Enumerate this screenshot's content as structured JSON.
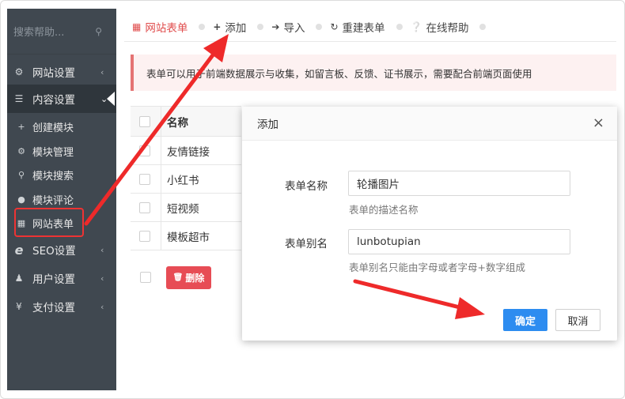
{
  "sidebar": {
    "search_placeholder": "搜索帮助...",
    "items": [
      {
        "label": "网站设置",
        "chevron": "‹"
      },
      {
        "label": "内容设置",
        "chevron": "⌄"
      },
      {
        "label": "SEO设置",
        "chevron": "‹"
      },
      {
        "label": "用户设置",
        "chevron": "‹"
      },
      {
        "label": "支付设置",
        "chevron": "‹"
      }
    ],
    "subitems": [
      {
        "label": "创建模块"
      },
      {
        "label": "模块管理"
      },
      {
        "label": "模块搜索"
      },
      {
        "label": "模块评论"
      },
      {
        "label": "网站表单"
      }
    ]
  },
  "topbar": {
    "tabs": [
      {
        "label": "网站表单",
        "icon": "table-icon"
      },
      {
        "label": "添加",
        "icon": "plus-icon"
      },
      {
        "label": "导入",
        "icon": "import-icon"
      },
      {
        "label": "重建表单",
        "icon": "refresh-icon"
      },
      {
        "label": "在线帮助",
        "icon": "help-icon"
      }
    ]
  },
  "notice": {
    "text": "表单可以用于前端数据展示与收集，如留言板、反馈、证书展示，需要配合前端页面使用"
  },
  "table": {
    "header": "名称",
    "rows": [
      "友情链接",
      "小红书",
      "短视频",
      "模板超市"
    ]
  },
  "actions": {
    "delete_label": "删除"
  },
  "modal": {
    "title": "添加",
    "close": "×",
    "fields": [
      {
        "label": "表单名称",
        "value": "轮播图片",
        "help": "表单的描述名称"
      },
      {
        "label": "表单别名",
        "value": "lunbotupian",
        "help": "表单别名只能由字母或者字母+数字组成"
      }
    ],
    "ok_label": "确定",
    "cancel_label": "取消"
  },
  "colors": {
    "sidebar_bg": "#404850",
    "accent_red": "#e04c4c",
    "primary_blue": "#2d8cf0",
    "annotation_red": "#ee3333"
  }
}
